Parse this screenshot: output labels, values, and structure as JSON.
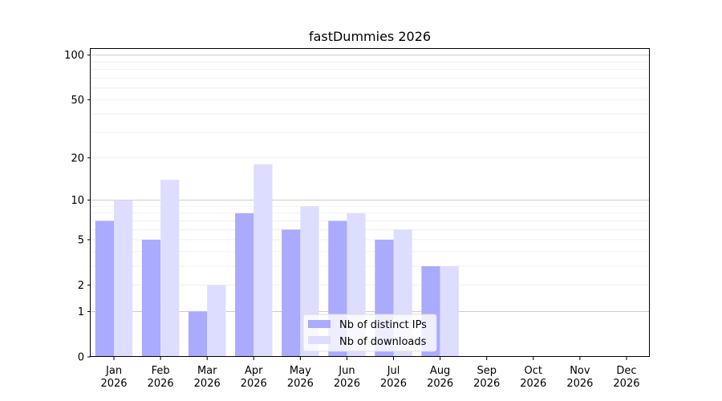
{
  "chart_data": {
    "type": "bar",
    "title": "fastDummies 2026",
    "xlabel": "",
    "ylabel": "",
    "y_scale": "symlog",
    "ylim": [
      0,
      110
    ],
    "y_ticks": [
      0,
      1,
      2,
      5,
      10,
      20,
      50,
      100
    ],
    "major_gridlines": [
      1,
      10,
      100
    ],
    "grid": true,
    "legend": "bottom-center",
    "categories": [
      {
        "month": "Jan",
        "year": "2026"
      },
      {
        "month": "Feb",
        "year": "2026"
      },
      {
        "month": "Mar",
        "year": "2026"
      },
      {
        "month": "Apr",
        "year": "2026"
      },
      {
        "month": "May",
        "year": "2026"
      },
      {
        "month": "Jun",
        "year": "2026"
      },
      {
        "month": "Jul",
        "year": "2026"
      },
      {
        "month": "Aug",
        "year": "2026"
      },
      {
        "month": "Sep",
        "year": "2026"
      },
      {
        "month": "Oct",
        "year": "2026"
      },
      {
        "month": "Nov",
        "year": "2026"
      },
      {
        "month": "Dec",
        "year": "2026"
      }
    ],
    "series": [
      {
        "name": "Nb of distinct IPs",
        "color": "#aaaaff",
        "values": [
          7,
          5,
          1,
          8,
          6,
          7,
          5,
          3,
          0,
          0,
          0,
          0
        ]
      },
      {
        "name": "Nb of downloads",
        "color": "#ddddff",
        "values": [
          10,
          14,
          2,
          18,
          9,
          8,
          6,
          3,
          0,
          0,
          0,
          0
        ]
      }
    ]
  }
}
